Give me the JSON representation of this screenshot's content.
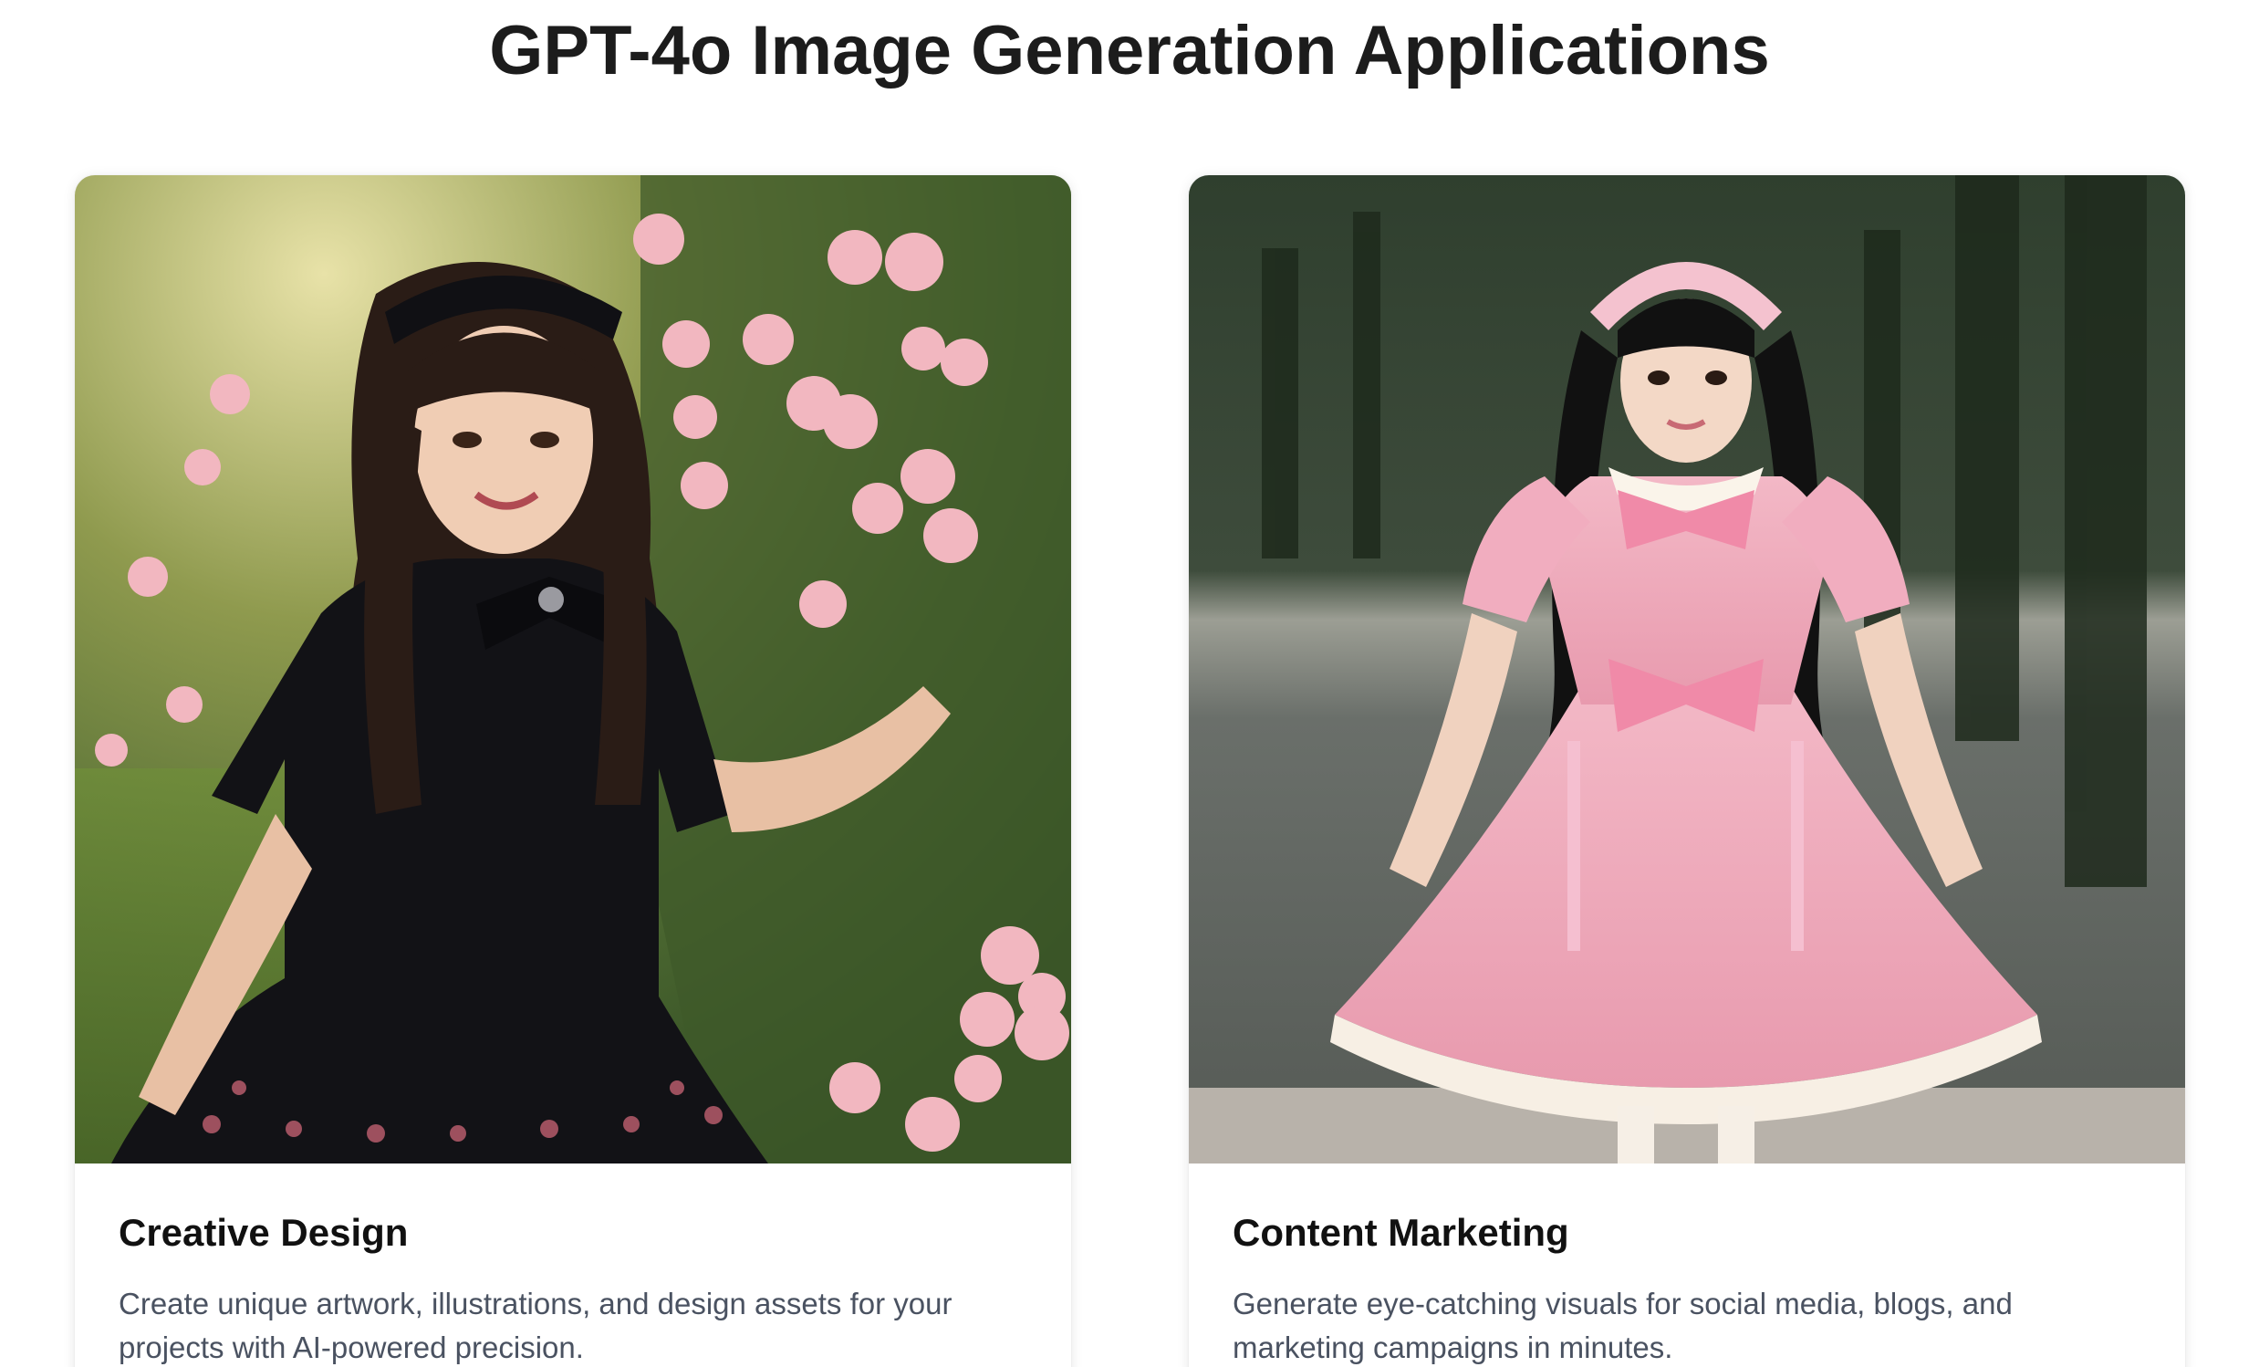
{
  "page": {
    "title": "GPT-4o Image Generation Applications"
  },
  "cards": [
    {
      "title": "Creative Design",
      "description": "Create unique artwork, illustrations, and design assets for your projects with AI-powered precision.",
      "image_subject": "woman in black gothic lolita dress in rose garden"
    },
    {
      "title": "Content Marketing",
      "description": "Generate eye-catching visuals for social media, blogs, and marketing campaigns in minutes.",
      "image_subject": "girl in pink lolita dress on park path"
    }
  ],
  "colors": {
    "title_text": "#1c1c1c",
    "card_title": "#111111",
    "card_desc": "#4a5261",
    "background": "#ffffff"
  }
}
